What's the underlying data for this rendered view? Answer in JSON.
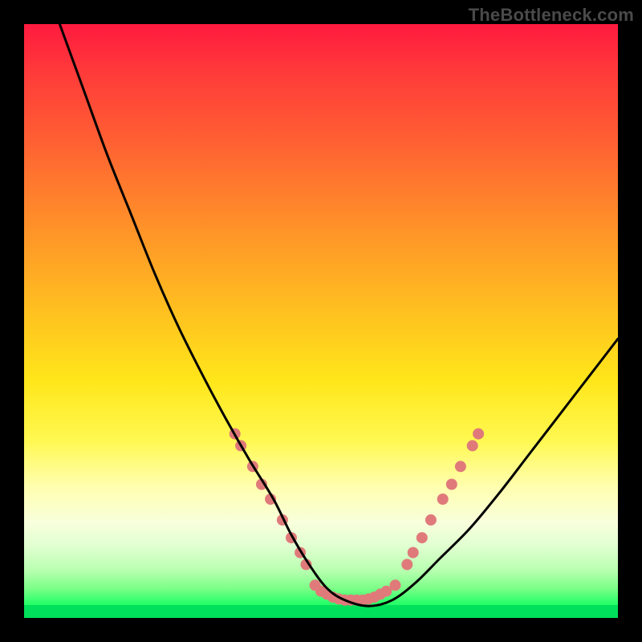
{
  "watermark": "TheBottleneck.com",
  "chart_data": {
    "type": "line",
    "title": "",
    "xlabel": "",
    "ylabel": "",
    "xlim": [
      0,
      100
    ],
    "ylim": [
      0,
      100
    ],
    "grid": false,
    "legend": false,
    "background_gradient": {
      "top": "#ff1a3f",
      "mid": "#ffe61a",
      "bottom": "#00e658",
      "description": "red-to-green vertical gradient representing bottleneck severity (red high, green low)"
    },
    "series": [
      {
        "name": "bottleneck-curve",
        "color": "#000000",
        "stroke_width": 3,
        "x": [
          6,
          10,
          14,
          18,
          22,
          26,
          30,
          34,
          38,
          42,
          45,
          48,
          51,
          54,
          58,
          62,
          66,
          70,
          75,
          80,
          85,
          90,
          95,
          100
        ],
        "values": [
          100,
          89,
          78,
          68,
          58,
          49,
          41,
          33.5,
          26.5,
          20,
          14,
          9,
          5,
          3,
          2,
          3,
          6,
          10,
          15,
          21,
          27.5,
          34,
          40.5,
          47
        ]
      }
    ],
    "annotations": {
      "marker_color": "#e07a7a",
      "marker_radius": 7,
      "points": [
        {
          "x": 35.5,
          "y": 31
        },
        {
          "x": 36.5,
          "y": 29
        },
        {
          "x": 38.5,
          "y": 25.5
        },
        {
          "x": 40,
          "y": 22.5
        },
        {
          "x": 41.5,
          "y": 20
        },
        {
          "x": 43.5,
          "y": 16.5
        },
        {
          "x": 45,
          "y": 13.5
        },
        {
          "x": 46.5,
          "y": 11
        },
        {
          "x": 47.5,
          "y": 9
        },
        {
          "x": 49,
          "y": 5.5
        },
        {
          "x": 50,
          "y": 4.5
        },
        {
          "x": 51,
          "y": 4
        },
        {
          "x": 52,
          "y": 3.5
        },
        {
          "x": 53,
          "y": 3.2
        },
        {
          "x": 54,
          "y": 3
        },
        {
          "x": 55,
          "y": 3
        },
        {
          "x": 56,
          "y": 3
        },
        {
          "x": 57,
          "y": 3
        },
        {
          "x": 58,
          "y": 3.2
        },
        {
          "x": 59,
          "y": 3.5
        },
        {
          "x": 60,
          "y": 4
        },
        {
          "x": 61,
          "y": 4.5
        },
        {
          "x": 62.5,
          "y": 5.5
        },
        {
          "x": 64.5,
          "y": 9
        },
        {
          "x": 65.5,
          "y": 11
        },
        {
          "x": 67,
          "y": 13.5
        },
        {
          "x": 68.5,
          "y": 16.5
        },
        {
          "x": 70.5,
          "y": 20
        },
        {
          "x": 72,
          "y": 22.5
        },
        {
          "x": 73.5,
          "y": 25.5
        },
        {
          "x": 75.5,
          "y": 29
        },
        {
          "x": 76.5,
          "y": 31
        }
      ]
    }
  }
}
